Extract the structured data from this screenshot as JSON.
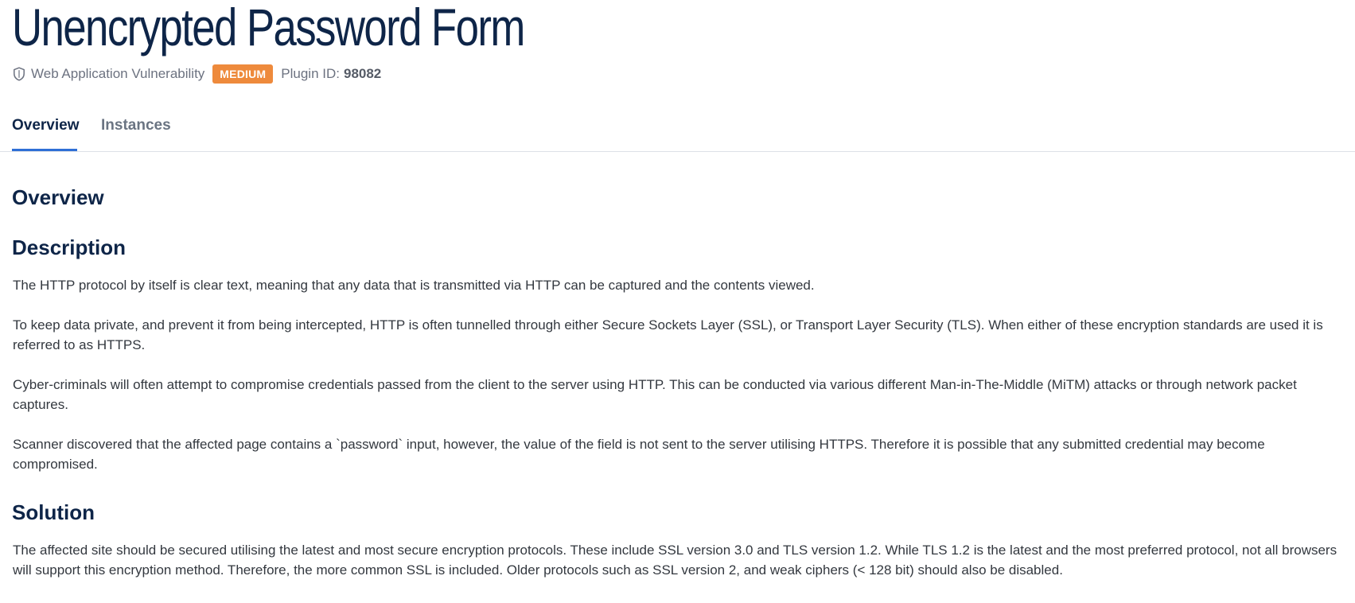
{
  "page": {
    "title": "Unencrypted Password Form",
    "meta": {
      "shield_icon": "shield-icon",
      "category": "Web Application Vulnerability",
      "severity": "MEDIUM",
      "severity_color": "#ee8a3c",
      "plugin_label": "Plugin ID:",
      "plugin_id": "98082"
    }
  },
  "tabs": [
    {
      "label": "Overview",
      "active": true
    },
    {
      "label": "Instances",
      "active": false
    }
  ],
  "content": {
    "overview_heading": "Overview",
    "description_heading": "Description",
    "description_paragraphs": [
      "The HTTP protocol by itself is clear text, meaning that any data that is transmitted via HTTP can be captured and the contents viewed.",
      "To keep data private, and prevent it from being intercepted, HTTP is often tunnelled through either Secure Sockets Layer (SSL), or Transport Layer Security (TLS). When either of these encryption standards are used it is referred to as HTTPS.",
      "Cyber-criminals will often attempt to compromise credentials passed from the client to the server using HTTP. This can be conducted via various different Man-in-The-Middle (MiTM) attacks or through network packet captures.",
      "Scanner discovered that the affected page contains a `password` input, however, the value of the field is not sent to the server utilising HTTPS. Therefore it is possible that any submitted credential may become compromised."
    ],
    "solution_heading": "Solution",
    "solution_paragraphs": [
      "The affected site should be secured utilising the latest and most secure encryption protocols. These include SSL version 3.0 and TLS version 1.2. While TLS 1.2 is the latest and the most preferred protocol, not all browsers will support this encryption method. Therefore, the more common SSL is included. Older protocols such as SSL version 2, and weak ciphers (< 128 bit) should also be disabled."
    ]
  },
  "colors": {
    "heading": "#0e2548",
    "tab_active_underline": "#2f6fd6",
    "body_text": "#33383f"
  }
}
